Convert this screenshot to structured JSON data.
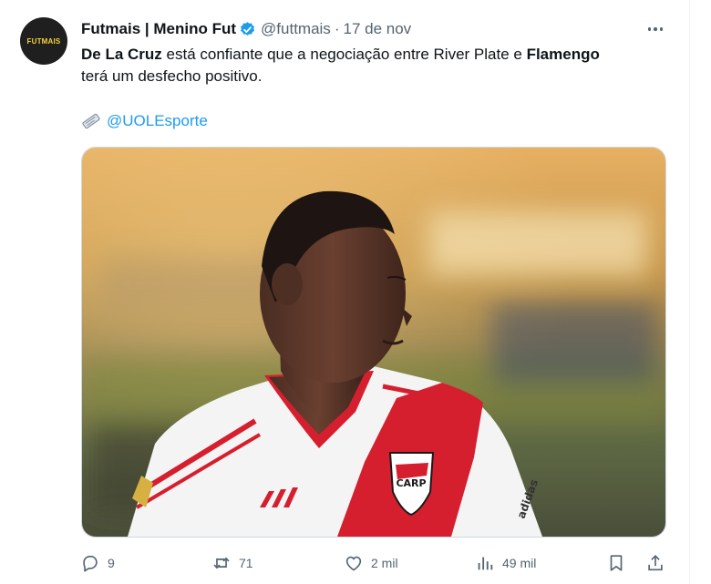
{
  "tweet": {
    "avatar_text": "FUTMAIS",
    "display_name": "Futmais | Menino Fut",
    "handle": "@futtmais",
    "separator": "·",
    "date": "17 de nov",
    "text": {
      "part1": "De La Cruz",
      "part2": " está confiante que a negociação entre River Plate e ",
      "part3": "Flamengo",
      "part4": "terá um desfecho positivo."
    },
    "source_mention": "@UOLEsporte",
    "media_kit_sponsor": "adidas",
    "media_kit_logo": "CARP"
  },
  "actions": {
    "replies": "9",
    "retweets": "71",
    "likes": "2 mil",
    "views": "49 mil"
  },
  "icons": {
    "verified": "verified-badge-icon",
    "more": "more-icon",
    "source": "newspaper-icon",
    "reply": "reply-icon",
    "retweet": "retweet-icon",
    "like": "heart-icon",
    "views": "analytics-icon",
    "bookmark": "bookmark-icon",
    "share": "share-icon"
  },
  "colors": {
    "accent": "#1d9bf0",
    "muted": "#536471",
    "jersey_red": "#d51f2e",
    "avatar_bg": "#1f1f1f",
    "avatar_text": "#f5d23a"
  }
}
